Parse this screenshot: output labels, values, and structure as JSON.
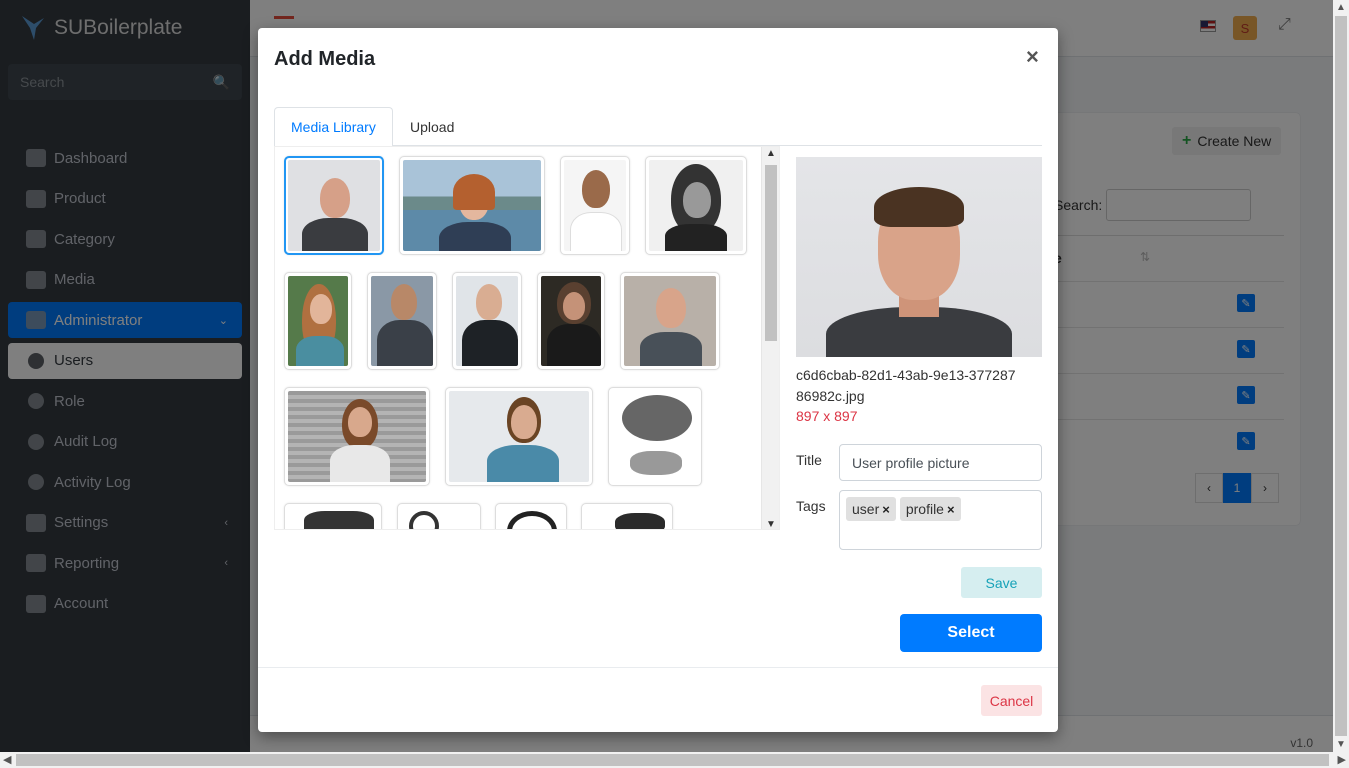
{
  "app": {
    "brand": "SUBoilerplate",
    "search_placeholder": "Search",
    "nav": [
      {
        "label": "Dashboard"
      },
      {
        "label": "Product"
      },
      {
        "label": "Category"
      },
      {
        "label": "Media"
      },
      {
        "label": "Administrator"
      },
      {
        "label": "Users"
      },
      {
        "label": "Role"
      },
      {
        "label": "Audit Log"
      },
      {
        "label": "Activity Log"
      },
      {
        "label": "Settings"
      },
      {
        "label": "Reporting"
      },
      {
        "label": "Account"
      }
    ],
    "user_initial": "S",
    "create_new": "Create New",
    "search_label": "Search:",
    "table_header": "e",
    "page_current": "1",
    "version": "v1.0"
  },
  "modal": {
    "title": "Add Media",
    "close": "×",
    "tabs": [
      {
        "label": "Media Library"
      },
      {
        "label": "Upload"
      }
    ],
    "selected": {
      "filename": "c6d6cbab-82d1-43ab-9e13-37728786982c.jpg",
      "dimensions": "897 x 897",
      "title_label": "Title",
      "title_value": "User profile picture",
      "tags_label": "Tags",
      "tags": [
        "user",
        "profile"
      ],
      "tag_remove": "×"
    },
    "save_label": "Save",
    "select_label": "Select",
    "cancel_label": "Cancel"
  }
}
